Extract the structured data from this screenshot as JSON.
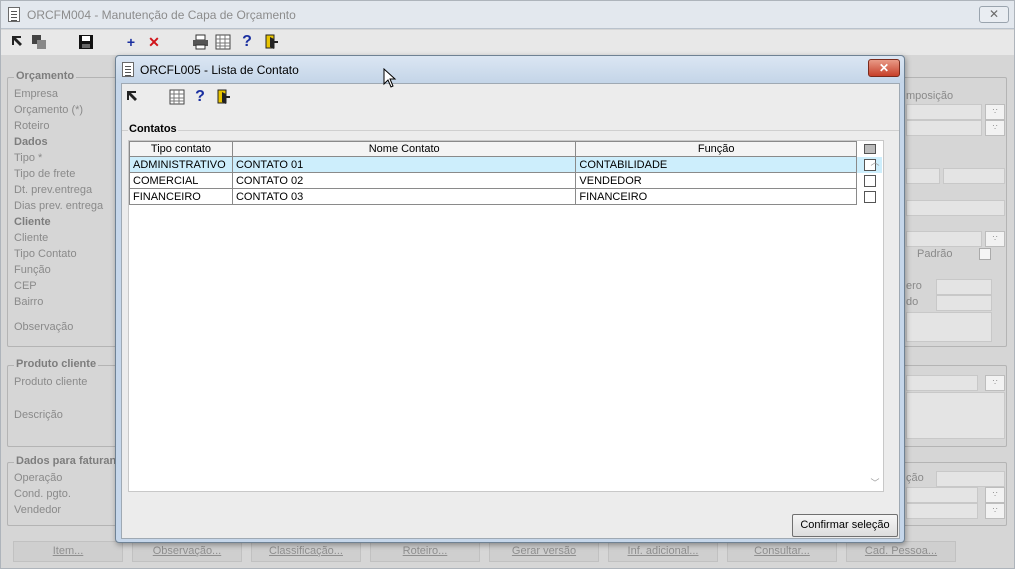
{
  "main_window": {
    "title": "ORCFM004 - Manutenção de Capa de Orçamento",
    "close_label": "✕",
    "toolbar": {
      "icons": [
        "arrow-icon",
        "copy-icon",
        "save-icon",
        "add-icon",
        "delete-icon",
        "print-icon",
        "grid-icon",
        "help-icon",
        "exit-icon"
      ],
      "add_glyph": "+",
      "delete_glyph": "✕",
      "help_glyph": "?"
    },
    "groups": {
      "orcamento": {
        "title": "Orçamento",
        "labels": [
          "Empresa",
          "Orçamento (*)",
          "Roteiro"
        ],
        "dados_title": "Dados",
        "dados_labels": [
          "Tipo *",
          "Tipo de frete",
          "Dt. prev.entrega",
          "Dias prev. entrega"
        ],
        "cliente_title": "Cliente",
        "cliente_labels": [
          "Cliente",
          "Tipo Contato",
          "Função",
          "CEP",
          "Bairro",
          "Observação"
        ],
        "right_partial": {
          "composicao": "mposição",
          "padrao": "Padrão",
          "numero": "ero",
          "estado": "do"
        }
      },
      "produto_cliente": {
        "title": "Produto cliente",
        "labels": [
          "Produto cliente",
          "Descrição"
        ]
      },
      "dados_faturamento": {
        "title": "Dados para faturan",
        "labels": [
          "Operação",
          "Cond. pgto.",
          "Vendedor"
        ],
        "right_partial": "ção"
      }
    },
    "buttons": [
      "Item...",
      "Observação...",
      "Classificação...",
      "Roteiro...",
      "Gerar versão",
      "Inf. adicional...",
      "Consultar...",
      "Cad. Pessoa..."
    ]
  },
  "dialog": {
    "title": "ORCFL005 - Lista de Contato",
    "close_label": "✕",
    "toolbar": {
      "icons": [
        "arrow-icon",
        "grid-icon",
        "help-icon",
        "exit-icon"
      ],
      "help_glyph": "?"
    },
    "group_title": "Contatos",
    "columns": [
      "Tipo contato",
      "Nome Contato",
      "Função"
    ],
    "rows": [
      {
        "tipo": "ADMINISTRATIVO",
        "nome": "CONTATO 01",
        "funcao": "CONTABILIDADE",
        "selected": true,
        "checked": false
      },
      {
        "tipo": "COMERCIAL",
        "nome": "CONTATO 02",
        "funcao": "VENDEDOR",
        "selected": false,
        "checked": false
      },
      {
        "tipo": "FINANCEIRO",
        "nome": "CONTATO 03",
        "funcao": "FINANCEIRO",
        "selected": false,
        "checked": false
      }
    ],
    "confirm_label": "Confirmar seleção"
  },
  "colors": {
    "dialog_frame": "#c5d6ea",
    "selected_row": "#cdeefc",
    "close_red": "#c7402a",
    "toolbar_blue": "#1a2fa0",
    "toolbar_red": "#d0141a"
  }
}
